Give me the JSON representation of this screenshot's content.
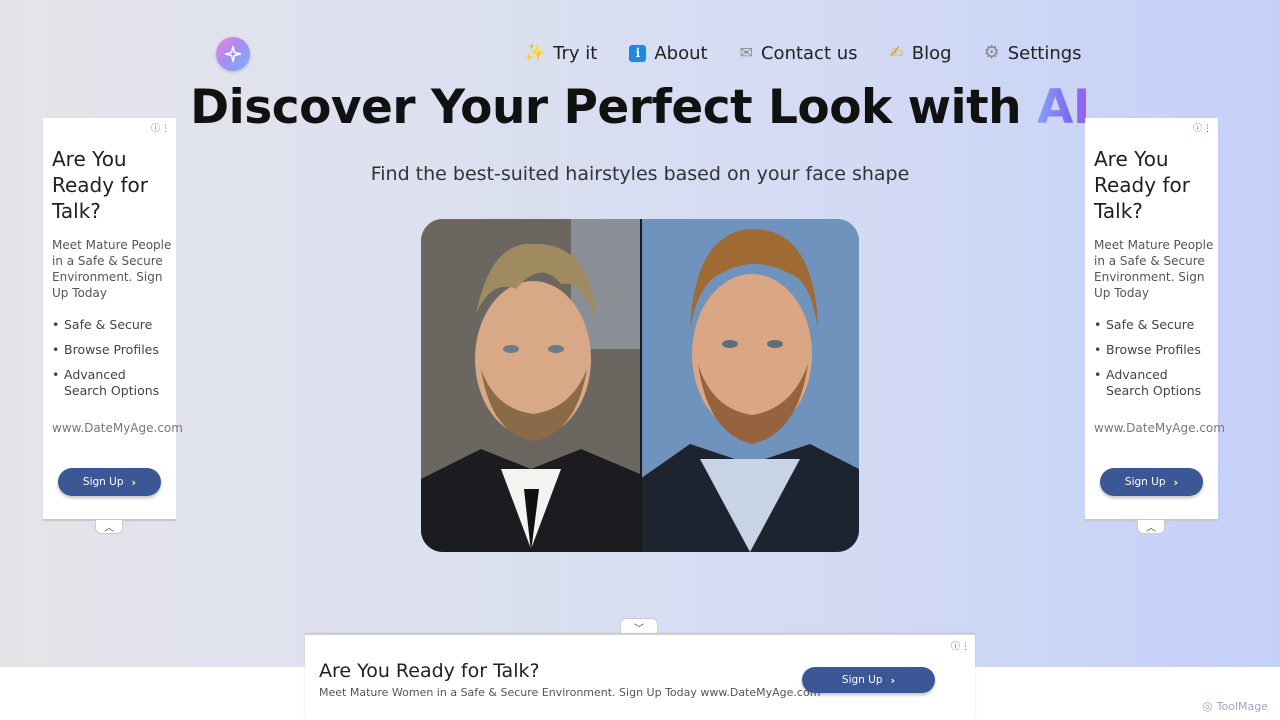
{
  "nav": {
    "items": [
      {
        "icon": "sparkles-icon",
        "glyph": "✨",
        "label": "Try it"
      },
      {
        "icon": "info-icon",
        "glyph": "i",
        "label": "About"
      },
      {
        "icon": "envelope-icon",
        "glyph": "✉",
        "label": "Contact us"
      },
      {
        "icon": "pencil-icon",
        "glyph": "✍",
        "label": "Blog"
      },
      {
        "icon": "gear-icon",
        "glyph": "⚙",
        "label": "Settings"
      }
    ]
  },
  "hero": {
    "title_main": "Discover Your Perfect Look with",
    "title_accent": "AI",
    "subtitle": "Find the best-suited hairstyles based on your face shape"
  },
  "side_ad": {
    "headline": "Are You Ready for Talk?",
    "body": "Meet Mature People in a Safe & Secure Environment. Sign Up Today",
    "bullets": [
      "Safe & Secure",
      "Browse Profiles",
      "Advanced Search Options"
    ],
    "url": "www.DateMyAge.com",
    "button": "Sign Up"
  },
  "bottom_ad": {
    "headline": "Are You Ready for Talk?",
    "body": "Meet Mature Women in a Safe & Secure Environment. Sign Up Today www.DateMyAge.com",
    "button": "Sign Up"
  },
  "watermark": {
    "text": "ToolMage"
  },
  "colors": {
    "accent_gradient_start": "#8aa0f4",
    "accent_gradient_end": "#9a63ee",
    "ad_button": "#3c5796"
  }
}
